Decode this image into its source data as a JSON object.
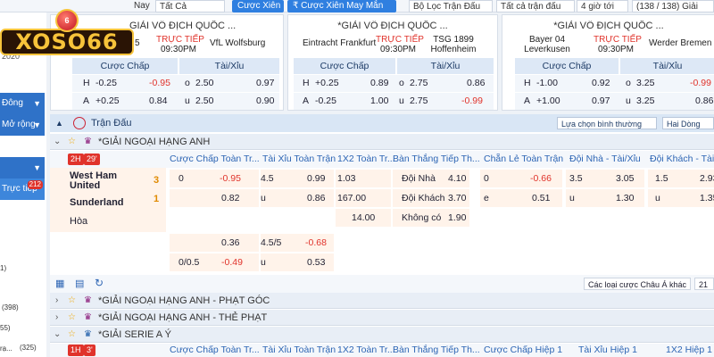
{
  "topbar": {
    "nav_fragment": "Nay",
    "filter_all": "Tất Cả",
    "btn_xien": "Cược Xiên",
    "btn_xien_may_man": "₹ Cược Xiên May Mắn",
    "filter_match": "Bộ Lọc Trận Đấu",
    "all_matches": "Tất cả trận đấu",
    "hours": "4 giờ tới",
    "count": "(138 / 138) Giải"
  },
  "logo": {
    "text": "XOSO66",
    "ball": "6"
  },
  "sidebar": {
    "snippet1": "2020",
    "item1": "Đông",
    "item2": "Mở rộng",
    "item3": "Trực tiếp",
    "badge": "212",
    "counts": [
      "1)",
      "(398)",
      "55)",
      "(325)"
    ],
    "last_label": "rạ..."
  },
  "cards": [
    {
      "league": "GIẢI VÔ ĐỊCH QUỐC ...",
      "home": "5",
      "status": "TRỰC TIẾP",
      "time": "09:30PM",
      "away": "VfL Wolfsburg",
      "h_label": "Cược Chấp",
      "t_label": "Tài/Xỉu",
      "rows": [
        {
          "s": "H",
          "hv": "-0.25",
          "ho": "-0.95",
          "ts": "o",
          "tv": "2.50",
          "to": "0.97"
        },
        {
          "s": "A",
          "hv": "+0.25",
          "ho": "0.84",
          "ts": "u",
          "tv": "2.50",
          "to": "0.90"
        }
      ]
    },
    {
      "league": "*GIẢI VÔ ĐỊCH QUỐC ...",
      "home": "Eintracht Frankfurt",
      "status": "TRỰC TIẾP",
      "time": "09:30PM",
      "away": "TSG 1899 Hoffenheim",
      "h_label": "Cược Chấp",
      "t_label": "Tài/Xỉu",
      "rows": [
        {
          "s": "H",
          "hv": "+0.25",
          "ho": "0.89",
          "ts": "o",
          "tv": "2.75",
          "to": "0.86"
        },
        {
          "s": "A",
          "hv": "-0.25",
          "ho": "1.00",
          "ts": "u",
          "tv": "2.75",
          "to": "-0.99"
        }
      ]
    },
    {
      "league": "*GIẢI VÔ ĐỊCH QUỐC ...",
      "home": "Bayer 04 Leverkusen",
      "status": "TRỰC TIẾP",
      "time": "09:30PM",
      "away": "Werder Bremen",
      "h_label": "Cược Chấp",
      "t_label": "Tài/Xỉu",
      "rows": [
        {
          "s": "H",
          "hv": "-1.00",
          "ho": "0.92",
          "ts": "o",
          "tv": "3.25",
          "to": "-0.99"
        },
        {
          "s": "A",
          "hv": "+1.00",
          "ho": "0.97",
          "ts": "u",
          "tv": "3.25",
          "to": "0.86"
        }
      ]
    }
  ],
  "main": {
    "section_title": "Trận Đấu",
    "sort_btn": "Lựa chọn bình thường",
    "two_way": "Hai Dòng",
    "league1": "*GIẢI NGOẠI HẠNG ANH",
    "league_corner": "*GIẢI NGOẠI HẠNG ANH - PHẠT GÓC",
    "league_cards": "*GIẢI NGOẠI HẠNG ANH - THẺ PHẠT",
    "league_seriea": "*GIẢI SERIE A Ý",
    "headers": [
      "Cược Chấp Toàn Tr...",
      "Tài Xỉu Toàn Trận",
      "1X2 Toàn Tr...",
      "Bàn Thắng Tiếp Th...",
      "Chẵn Lẻ Toàn Trận",
      "Đội Nhà - Tài/Xỉu",
      "Đội Khách - Tài/Xỉu"
    ],
    "headers2": [
      "Cược Chấp Toàn Tr...",
      "Tài Xỉu Toàn Trận",
      "1X2 Toàn Tr...",
      "Bàn Thắng Tiếp Th...",
      "Cược Chấp Hiệp 1",
      "Tài Xỉu Hiệp 1",
      "1X2 Hiệp 1"
    ],
    "match": {
      "period": "2H",
      "minute": "29'",
      "home": "West Ham United",
      "away": "Sunderland",
      "draw": "Hòa",
      "home_score": "3",
      "away_score": "1"
    },
    "match2": {
      "period": "1H",
      "minute": "3'"
    },
    "odds": {
      "r1": [
        "0",
        "-0.95",
        "4.5",
        "0.99",
        "1.03",
        "Đội Nhà",
        "4.10",
        "0",
        "-0.66",
        "3.5",
        "3.05",
        "1.5",
        "2.93"
      ],
      "r2": [
        "0.82",
        "u",
        "0.86",
        "167.00",
        "Đội Khách",
        "3.70",
        "e",
        "0.51",
        "u",
        "1.30",
        "u",
        "1.35"
      ],
      "r3": [
        "14.00",
        "Không có",
        "1.90"
      ],
      "r4": [
        "0.36",
        "4.5/5",
        "-0.68"
      ],
      "r5": [
        "0/0.5",
        "-0.49",
        "u",
        "0.53"
      ]
    },
    "other_odds_select": "Các loại cược Châu Á khác",
    "page_size": "21"
  }
}
